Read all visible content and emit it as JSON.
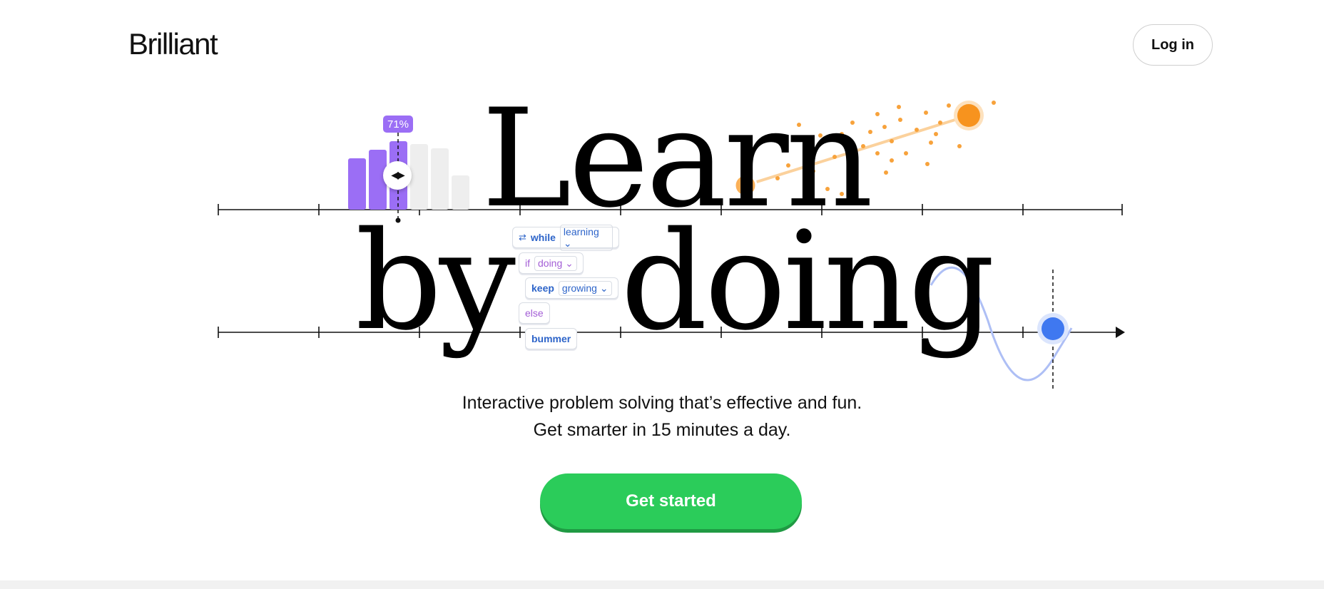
{
  "brand": {
    "name": "Brilliant"
  },
  "header": {
    "login_label": "Log in"
  },
  "hero": {
    "headline_line1": "Learn",
    "headline_line2_a": "by",
    "headline_line2_b": "doing",
    "percent_badge": "71%",
    "code_block": {
      "row1": {
        "keyword": "while",
        "arg": "learning"
      },
      "row2": {
        "keyword": "if",
        "arg": "doing"
      },
      "row3": {
        "keyword": "keep",
        "arg": "growing"
      },
      "row4": {
        "keyword": "else"
      },
      "row5": {
        "keyword": "bummer"
      }
    }
  },
  "subtitle": {
    "line1": "Interactive problem solving that’s effective and fun.",
    "line2": "Get smarter in 15 minutes a day."
  },
  "cta": {
    "label": "Get started"
  },
  "colors": {
    "accent_green": "#2bcc5a",
    "purple": "#9b6ef5",
    "orange": "#f7a23b",
    "blue": "#3f78f0"
  }
}
